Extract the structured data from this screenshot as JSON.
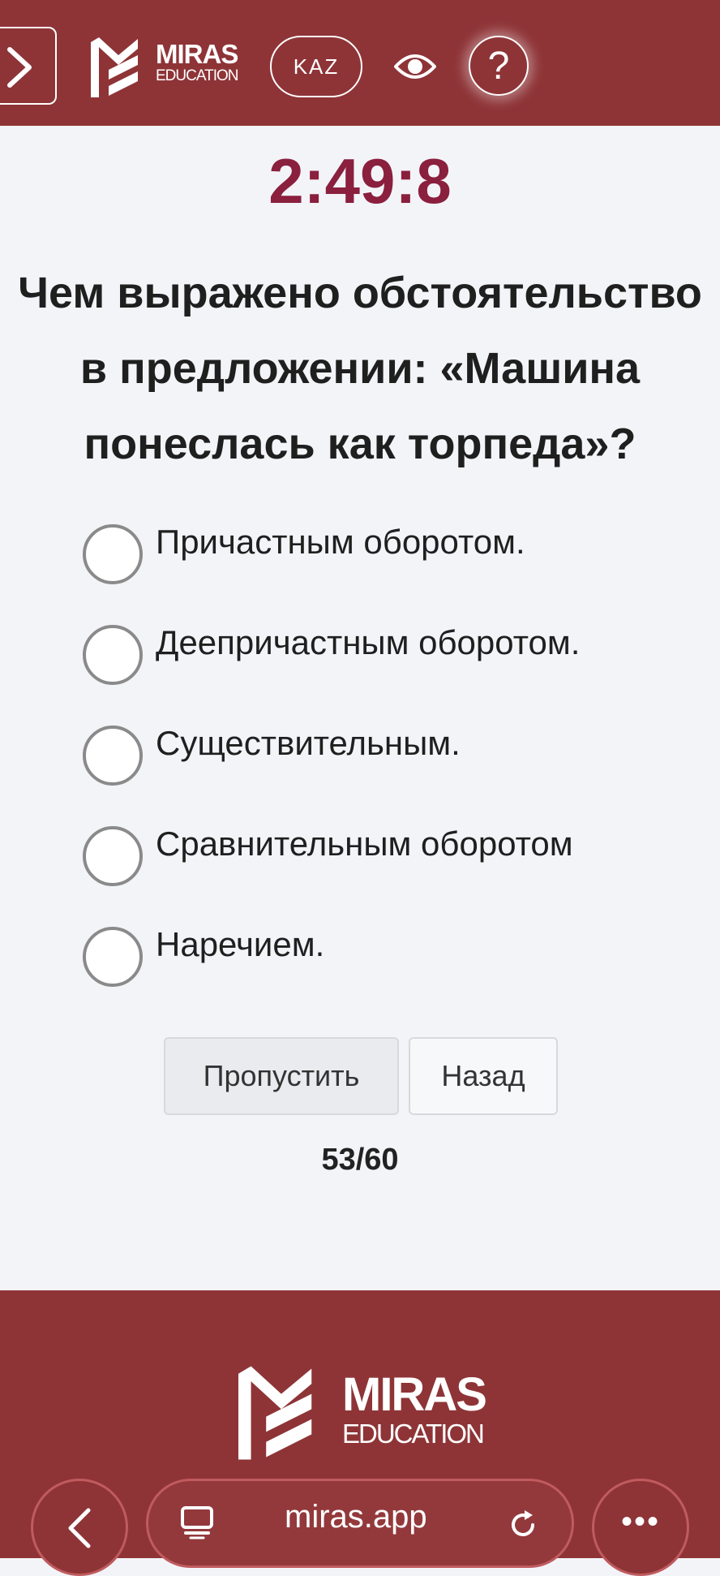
{
  "header": {
    "logo_big": "MIRAS",
    "logo_small": "EDUCATION",
    "language_button": "KAZ",
    "help_button": "?"
  },
  "timer": "2:49:8",
  "question": {
    "lines": [
      "Чем выражено обстоятельство",
      "в предложении: «Машина",
      "понеслась как торпеда»?"
    ]
  },
  "options": [
    "Причастным оборотом.",
    "Деепричастным оборотом.",
    "Существительным.",
    "Сравнительным оборотом",
    "Наречием."
  ],
  "actions": {
    "skip_label": "Пропустить",
    "back_label": "Назад"
  },
  "progress": "53/60",
  "footer": {
    "logo_big": "MIRAS",
    "logo_small": "EDUCATION"
  },
  "browser": {
    "url": "miras.app",
    "more": "•••"
  },
  "colors": {
    "brand": "#8e3437",
    "timer": "#8a1f3e"
  }
}
